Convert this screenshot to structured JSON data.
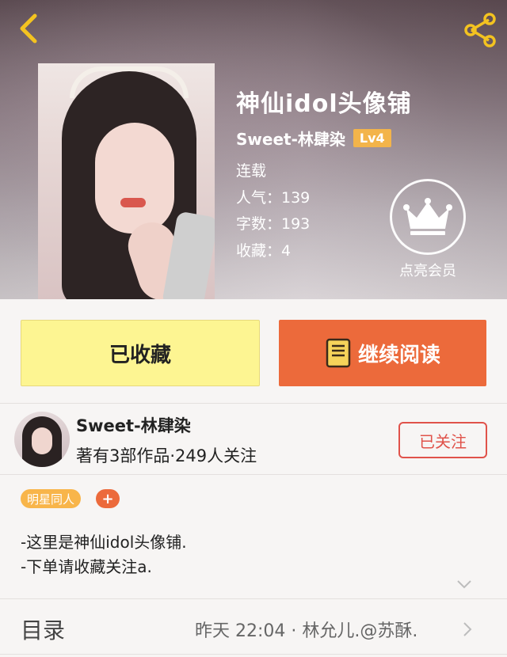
{
  "book": {
    "title": "神仙idol头像铺",
    "author": "Sweet-林肆染",
    "level": "Lv4",
    "status": "连载",
    "popularity": "人气：139",
    "word_count": "字数：193",
    "favorites": "收藏：4"
  },
  "vip": {
    "label": "点亮会员"
  },
  "actions": {
    "collect_label": "已收藏",
    "read_label": "继续阅读"
  },
  "author_card": {
    "name": "Sweet-林肆染",
    "summary": "著有3部作品·249人关注",
    "follow_label": "已关注"
  },
  "tags": {
    "items": [
      "明星同人"
    ],
    "add": "+"
  },
  "description": {
    "lines": [
      "-这里是神仙idol头像铺.",
      "-下单请收藏关注a."
    ]
  },
  "toc": {
    "label": "目录",
    "latest": "昨天 22:04 · 林允儿.@苏酥."
  },
  "icons": {
    "back": "chevron-left-icon",
    "share": "share-icon",
    "crown": "crown-icon",
    "book": "book-icon"
  },
  "colors": {
    "accent": "#ec6a3b",
    "collect_bg": "#fdf592",
    "level_badge": "#f3b44a",
    "follow": "#e0524a"
  }
}
